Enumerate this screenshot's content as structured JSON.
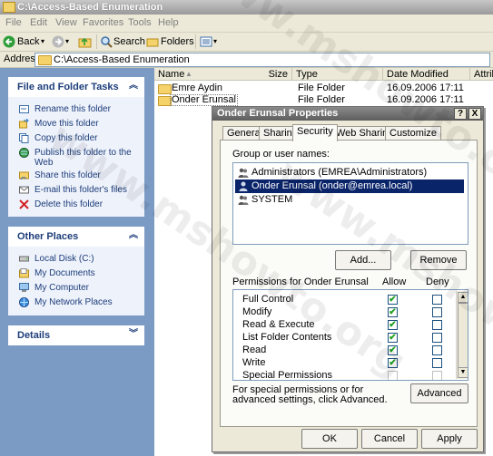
{
  "window": {
    "title": "C:\\Access-Based Enumeration"
  },
  "menu": [
    "File",
    "Edit",
    "View",
    "Favorites",
    "Tools",
    "Help"
  ],
  "toolbar": {
    "back": "Back",
    "search": "Search",
    "folders": "Folders"
  },
  "address": {
    "label": "Address",
    "value": "C:\\Access-Based Enumeration"
  },
  "tasks": {
    "file_folder": {
      "title": "File and Folder Tasks",
      "items": [
        "Rename this folder",
        "Move this folder",
        "Copy this folder",
        "Publish this folder to the Web",
        "Share this folder",
        "E-mail this folder's files",
        "Delete this folder"
      ]
    },
    "other_places": {
      "title": "Other Places",
      "items": [
        "Local Disk (C:)",
        "My Documents",
        "My Computer",
        "My Network Places"
      ]
    },
    "details": {
      "title": "Details"
    }
  },
  "filelist": {
    "columns": [
      "Name",
      "Size",
      "Type",
      "Date Modified",
      "Attrib"
    ],
    "rows": [
      {
        "name": "Emre Aydin",
        "type": "File Folder",
        "date": "16.09.2006 17:11"
      },
      {
        "name": "Onder Erunsal",
        "type": "File Folder",
        "date": "16.09.2006 17:11"
      }
    ]
  },
  "dialog": {
    "title": "Onder Erunsal Properties",
    "help_btn": "?",
    "close_btn": "X",
    "tabs": [
      "General",
      "Sharing",
      "Security",
      "Web Sharing",
      "Customize"
    ],
    "active_tab": "Security",
    "group_label": "Group or user names:",
    "users": [
      "Administrators (EMREA\\Administrators)",
      "Onder Erunsal (onder@emrea.local)",
      "SYSTEM"
    ],
    "selected_user": 1,
    "add_btn": "Add...",
    "remove_btn": "Remove",
    "perm_label": "Permissions for Onder Erunsal",
    "allow_header": "Allow",
    "deny_header": "Deny",
    "permissions": [
      {
        "name": "Full Control",
        "allow": true,
        "deny": false
      },
      {
        "name": "Modify",
        "allow": true,
        "deny": false
      },
      {
        "name": "Read & Execute",
        "allow": true,
        "deny": false
      },
      {
        "name": "List Folder Contents",
        "allow": true,
        "deny": false
      },
      {
        "name": "Read",
        "allow": true,
        "deny": false
      },
      {
        "name": "Write",
        "allow": true,
        "deny": false
      },
      {
        "name": "Special Permissions",
        "allow": false,
        "deny": false
      }
    ],
    "special_text": "For special permissions or for advanced settings, click Advanced.",
    "advanced_btn": "Advanced",
    "ok_btn": "OK",
    "cancel_btn": "Cancel",
    "apply_btn": "Apply"
  },
  "watermark": "www.mshowto.org",
  "colors": {
    "title_bar": "#9a9a9a",
    "left_pane": "#7b9bc4",
    "selection": "#0a246a",
    "link": "#1c3d7a",
    "check": "#21a121"
  }
}
